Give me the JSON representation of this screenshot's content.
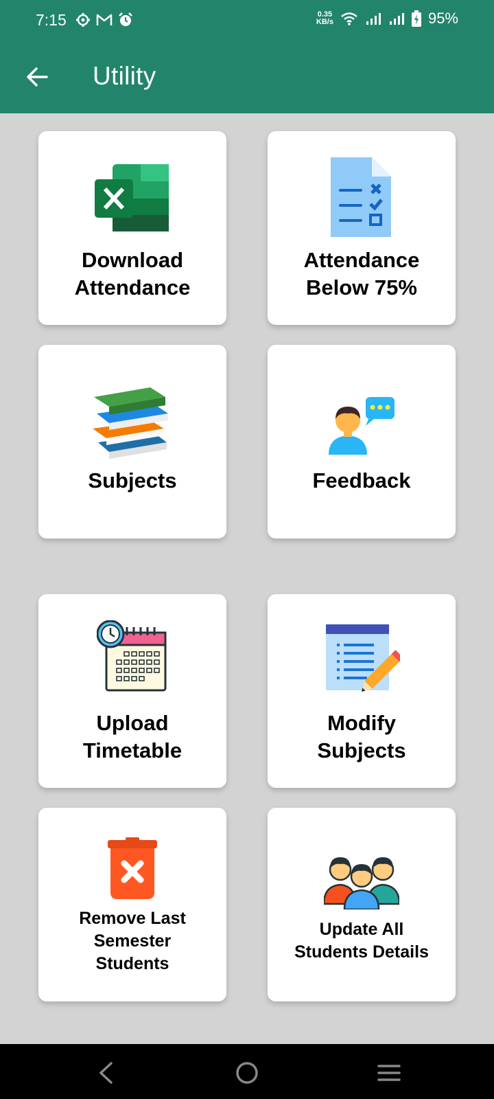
{
  "status_bar": {
    "time": "7:15",
    "left_icons": [
      "settings-gear-icon",
      "gmail-icon",
      "alarm-clock-icon"
    ],
    "network_speed_value": "0.35",
    "network_speed_unit": "KB/s",
    "battery": "95%"
  },
  "app_bar": {
    "title": "Utility",
    "back_icon": "arrow-back-icon"
  },
  "cards": [
    {
      "label_line1": "Download",
      "label_line2": "Attendance",
      "icon": "excel-icon"
    },
    {
      "label_line1": "Attendance",
      "label_line2": "Below 75%",
      "icon": "checklist-document-icon"
    },
    {
      "label_line1": "Subjects",
      "icon": "stack-of-books-icon"
    },
    {
      "label_line1": "Feedback",
      "icon": "person-feedback-icon"
    },
    {
      "label_line1": "Upload",
      "label_line2": "Timetable",
      "icon": "calendar-clock-icon"
    },
    {
      "label_line1": "Modify",
      "label_line2": "Subjects",
      "icon": "document-pencil-icon"
    },
    {
      "label_line1": "Remove Last",
      "label_line2": "Semester",
      "label_line3": "Students",
      "icon": "delete-bin-icon"
    },
    {
      "label_line1": "Update All",
      "label_line2": "Students Details",
      "icon": "students-group-icon"
    }
  ],
  "colors": {
    "app_bar": "#22856b",
    "background": "#d3d3d3",
    "card": "#ffffff"
  }
}
